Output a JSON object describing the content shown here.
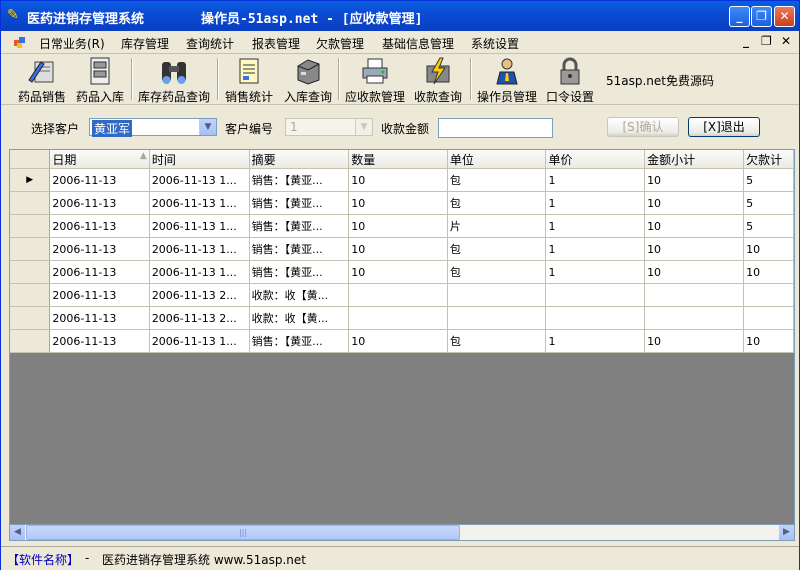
{
  "window": {
    "app_title": "医药进销存管理系统",
    "subtitle": "操作员-51asp.net - [应收款管理]",
    "min": "_",
    "max": "❐",
    "close": "✕"
  },
  "menu": {
    "items": [
      "日常业务(R)",
      "库存管理",
      "查询统计",
      "报表管理",
      "欠款管理",
      "基础信息管理",
      "系统设置"
    ],
    "mdi_min": "_",
    "mdi_restore": "❐",
    "mdi_close": "✕"
  },
  "toolbar": {
    "items": [
      {
        "label": "药品销售",
        "icon": "medicine-sale-icon"
      },
      {
        "label": "药品入库",
        "icon": "cabinet-icon"
      },
      {
        "label": "库存药品查询",
        "icon": "binoculars-icon"
      },
      {
        "label": "销售统计",
        "icon": "report-icon"
      },
      {
        "label": "入库查询",
        "icon": "file-cabinet-icon"
      },
      {
        "label": "应收款管理",
        "icon": "printer-icon"
      },
      {
        "label": "收款查询",
        "icon": "lightning-icon"
      },
      {
        "label": "操作员管理",
        "icon": "operator-icon"
      },
      {
        "label": "口令设置",
        "icon": "lock-icon"
      }
    ],
    "note": "51asp.net免费源码"
  },
  "filter": {
    "customer_label": "选择客户",
    "customer_value": "黄亚军",
    "customer_code_label": "客户编号",
    "customer_code_value": "1",
    "amount_label": "收款金额",
    "amount_value": "",
    "confirm_button": "[S]确认",
    "exit_button": "[X]退出"
  },
  "grid": {
    "columns": [
      "日期",
      "时间",
      "摘要",
      "数量",
      "单位",
      "单价",
      "金额小计",
      "欠款计"
    ],
    "current_row_marker": "▶",
    "rows": [
      [
        "2006-11-13",
        "2006-11-13 1...",
        "销售：【黄亚...",
        "10",
        "包",
        "1",
        "10",
        "5"
      ],
      [
        "2006-11-13",
        "2006-11-13 1...",
        "销售：【黄亚...",
        "10",
        "包",
        "1",
        "10",
        "5"
      ],
      [
        "2006-11-13",
        "2006-11-13 1...",
        "销售：【黄亚...",
        "10",
        "片",
        "1",
        "10",
        "5"
      ],
      [
        "2006-11-13",
        "2006-11-13 1...",
        "销售：【黄亚...",
        "10",
        "包",
        "1",
        "10",
        "10"
      ],
      [
        "2006-11-13",
        "2006-11-13 1...",
        "销售：【黄亚...",
        "10",
        "包",
        "1",
        "10",
        "10"
      ],
      [
        "2006-11-13",
        "2006-11-13 2...",
        "收款：收【黄...",
        "",
        "",
        "",
        "",
        ""
      ],
      [
        "2006-11-13",
        "2006-11-13 2...",
        "收款：收【黄...",
        "",
        "",
        "",
        "",
        ""
      ],
      [
        "2006-11-13",
        "2006-11-13 1...",
        "销售：【黄亚...",
        "10",
        "包",
        "1",
        "10",
        "10"
      ]
    ]
  },
  "scrollbar": {
    "left": "◀",
    "right": "▶",
    "grip": "|||"
  },
  "status": {
    "name": "【软件名称】",
    "dash": "-",
    "text": "医药进销存管理系统 www.51asp.net"
  }
}
